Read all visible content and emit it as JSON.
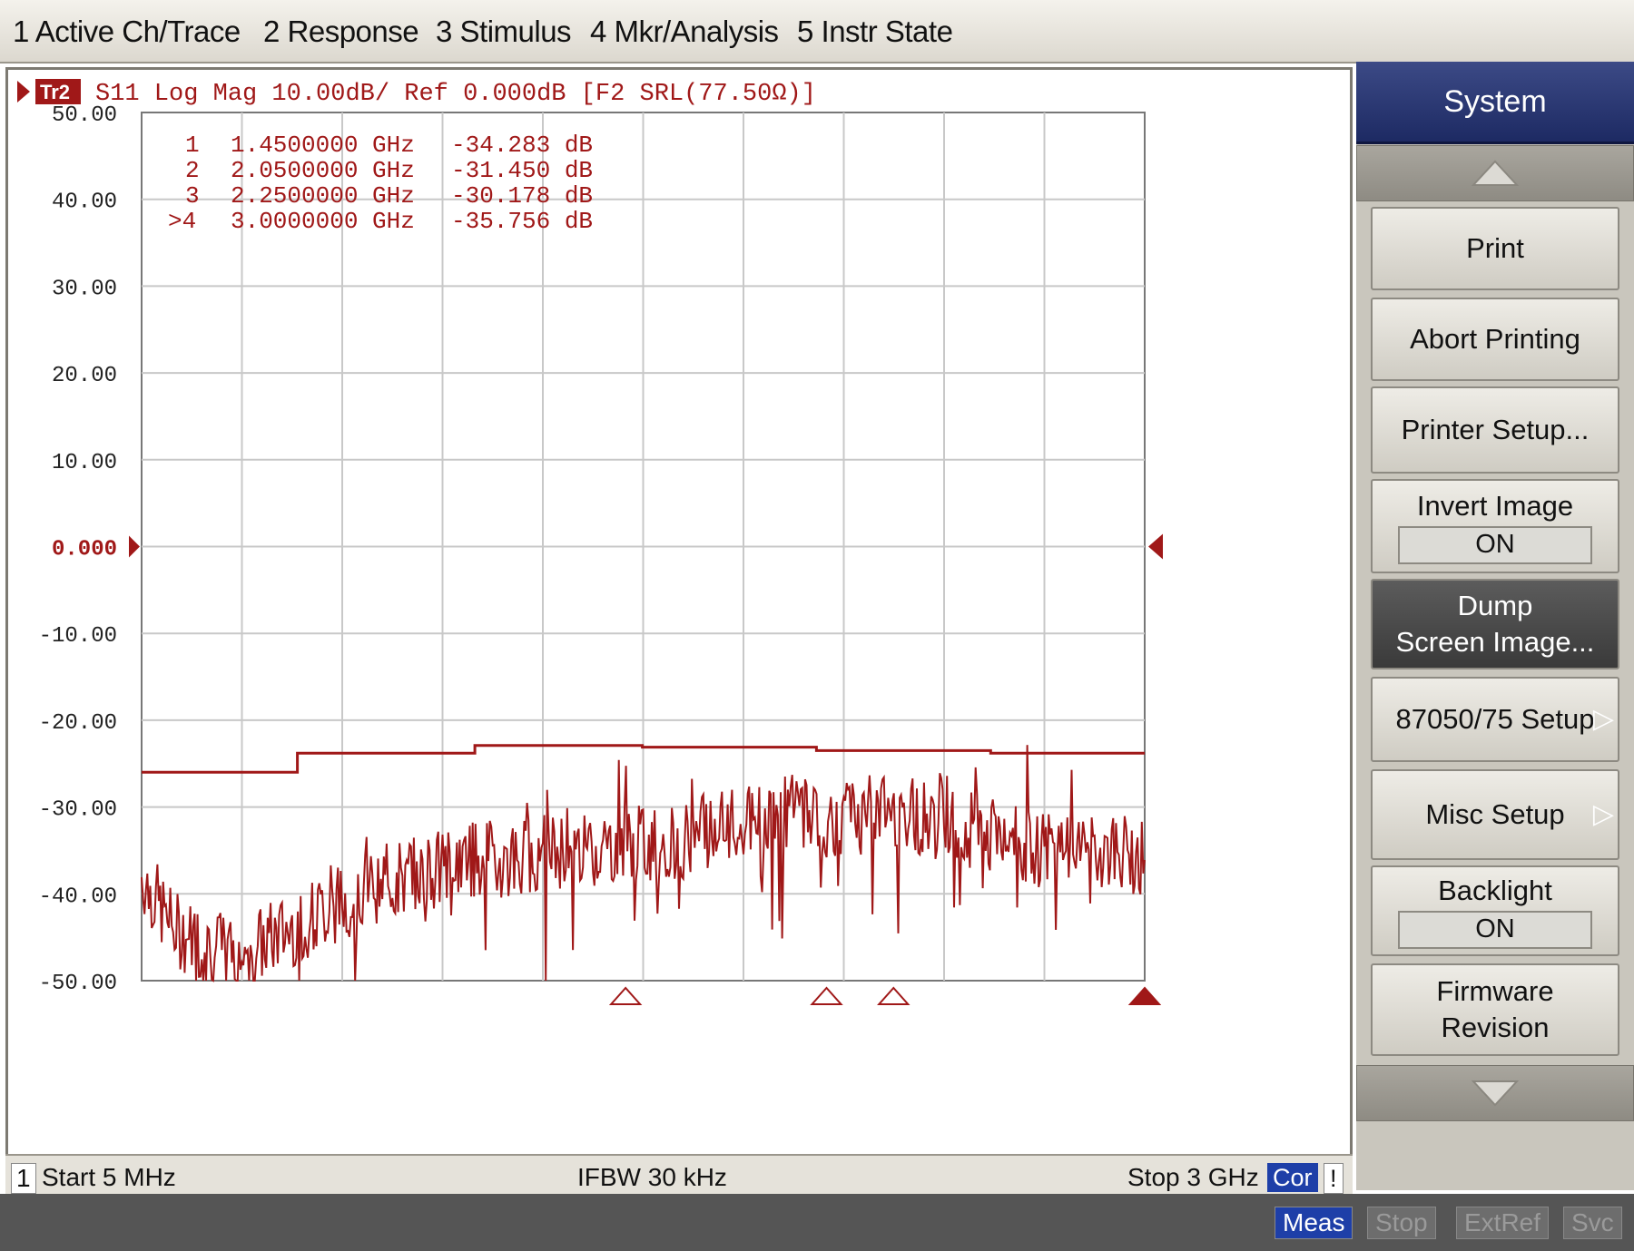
{
  "menu": {
    "items": [
      "1 Active Ch/Trace",
      "2 Response",
      "3 Stimulus",
      "4 Mkr/Analysis",
      "5 Instr State"
    ]
  },
  "trace": {
    "tag": "Tr2",
    "header": "S11 Log Mag 10.00dB/ Ref 0.000dB [F2 SRL(77.50Ω)]",
    "ref_value": "0.000"
  },
  "markers": [
    {
      "id": "1",
      "freq": "1.4500000 GHz",
      "value": "-34.283 dB"
    },
    {
      "id": "2",
      "freq": "2.0500000 GHz",
      "value": "-31.450 dB"
    },
    {
      "id": "3",
      "freq": "2.2500000 GHz",
      "value": "-30.178 dB"
    },
    {
      "id": ">4",
      "freq": "3.0000000 GHz",
      "value": "-35.756 dB"
    }
  ],
  "status": {
    "channel": "1",
    "start": "Start 5 MHz",
    "ifbw": "IFBW 30 kHz",
    "stop": "Stop 3 GHz",
    "cor": "Cor",
    "flag": "!"
  },
  "softkeys": {
    "title": "System",
    "print": "Print",
    "abort_printing": "Abort Printing",
    "printer_setup": "Printer Setup...",
    "invert_image": {
      "label": "Invert Image",
      "value": "ON"
    },
    "dump_line1": "Dump",
    "dump_line2": "Screen Image...",
    "setup_87050": "87050/75 Setup",
    "misc_setup": "Misc Setup",
    "backlight": {
      "label": "Backlight",
      "value": "ON"
    },
    "firmware_line1": "Firmware",
    "firmware_line2": "Revision"
  },
  "bottom": {
    "meas": "Meas",
    "stop": "Stop",
    "extref": "ExtRef",
    "svc": "Svc"
  },
  "colors": {
    "trace": "#a01818",
    "grid": "#c8c8c8",
    "title_bar": "#1d2a63"
  },
  "chart_data": {
    "type": "line",
    "title": "S11 Log Mag 10.00dB/ Ref 0.000dB [F2 SRL(77.50Ω)]",
    "xlabel": "",
    "ylabel": "",
    "xlim": [
      0.005,
      3.0
    ],
    "ylim": [
      -50,
      50
    ],
    "x_unit": "GHz",
    "y_unit": "dB",
    "y_tick_labels": [
      "50.00",
      "40.00",
      "30.00",
      "20.00",
      "10.00",
      "0.000",
      "-10.00",
      "-20.00",
      "-30.00",
      "-40.00",
      "-50.00"
    ],
    "grid": true,
    "limit_line": {
      "x": [
        0.005,
        0.47,
        0.47,
        1.0,
        1.0,
        1.5,
        1.5,
        2.02,
        2.02,
        2.54,
        2.54,
        3.0
      ],
      "y": [
        -26,
        -26,
        -23.8,
        -23.8,
        -22.9,
        -22.9,
        -23.1,
        -23.1,
        -23.5,
        -23.5,
        -23.8,
        -23.8
      ]
    },
    "series": [
      {
        "x": [
          0.005,
          0.1,
          0.2,
          0.3,
          0.4,
          0.5,
          0.6,
          0.7,
          0.8,
          0.9,
          1.0,
          1.1,
          1.2,
          1.3,
          1.45,
          1.6,
          1.7,
          1.8,
          1.9,
          2.0,
          2.05,
          2.15,
          2.25,
          2.4,
          2.5,
          2.6,
          2.7,
          2.8,
          2.9,
          3.0
        ],
        "y": [
          -38,
          -44,
          -46,
          -47,
          -45,
          -43,
          -41,
          -39,
          -38,
          -37,
          -36,
          -36,
          -35,
          -35,
          -34.3,
          -34,
          -33,
          -32,
          -31,
          -30,
          -31.5,
          -31,
          -30.2,
          -32,
          -33,
          -34,
          -35,
          -35.5,
          -35,
          -35.8
        ]
      }
    ],
    "markers": [
      {
        "id": "1",
        "x": 1.45,
        "y": -34.283
      },
      {
        "id": "2",
        "x": 2.05,
        "y": -31.45
      },
      {
        "id": "3",
        "x": 2.25,
        "y": -30.178
      },
      {
        "id": "4",
        "x": 3.0,
        "y": -35.756
      }
    ]
  }
}
